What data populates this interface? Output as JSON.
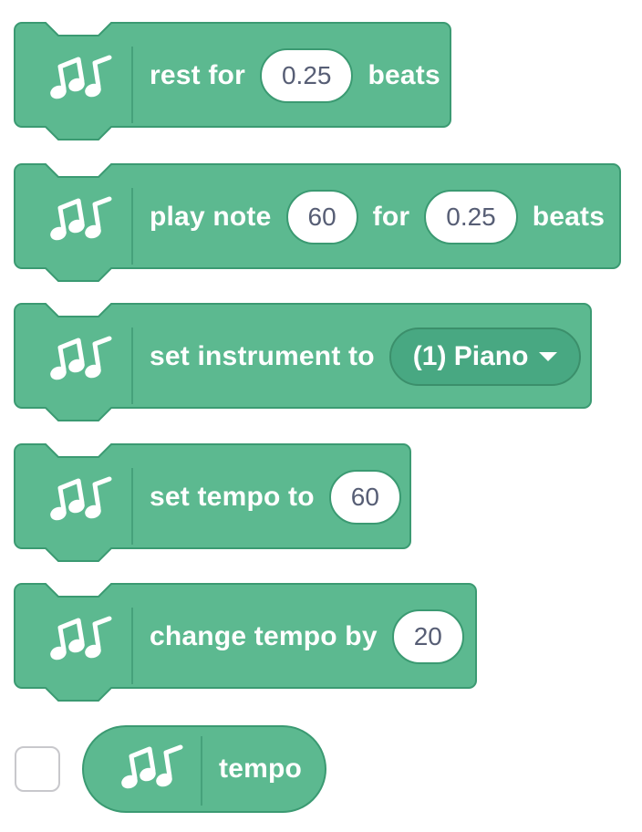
{
  "colors": {
    "block_fill": "#5cb990",
    "block_stroke": "#3b9a72",
    "field_text": "#575e75",
    "dropdown_fill": "#48a882"
  },
  "icon": {
    "name": "music-notes-icon"
  },
  "blocks": [
    {
      "id": "rest",
      "parts": [
        "rest for",
        "0.25",
        "beats"
      ]
    },
    {
      "id": "play-note",
      "parts": [
        "play note",
        "60",
        "for",
        "0.25",
        "beats"
      ]
    },
    {
      "id": "set-instrument",
      "label": "set instrument to",
      "dropdown_value": "(1) Piano"
    },
    {
      "id": "set-tempo",
      "label": "set tempo to",
      "value": "60"
    },
    {
      "id": "change-tempo",
      "label": "change tempo by",
      "value": "20"
    },
    {
      "id": "tempo-reporter",
      "label": "tempo",
      "checkbox_checked": false
    }
  ]
}
